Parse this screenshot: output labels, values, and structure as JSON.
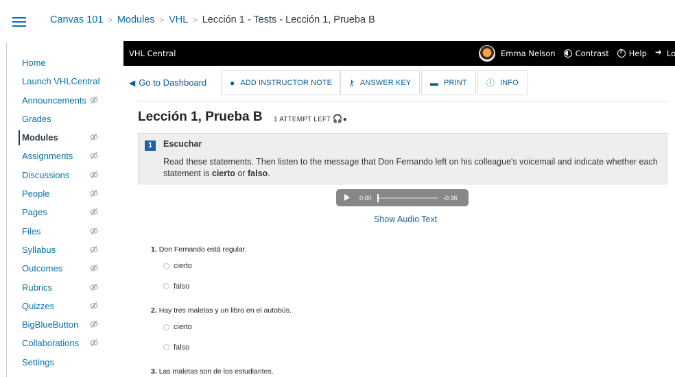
{
  "breadcrumb": {
    "items": [
      "Canvas 101",
      "Modules",
      "VHL",
      "Lección 1 - Tests - Lección 1, Prueba B"
    ],
    "separator": ">"
  },
  "course_nav": {
    "items": [
      {
        "label": "Home",
        "hidden_icon": false,
        "active": false
      },
      {
        "label": "Launch VHLCentral",
        "hidden_icon": false,
        "active": false
      },
      {
        "label": "Announcements",
        "hidden_icon": true,
        "active": false
      },
      {
        "label": "Grades",
        "hidden_icon": false,
        "active": false
      },
      {
        "label": "Modules",
        "hidden_icon": true,
        "active": true
      },
      {
        "label": "Assignments",
        "hidden_icon": true,
        "active": false
      },
      {
        "label": "Discussions",
        "hidden_icon": true,
        "active": false
      },
      {
        "label": "People",
        "hidden_icon": true,
        "active": false
      },
      {
        "label": "Pages",
        "hidden_icon": true,
        "active": false
      },
      {
        "label": "Files",
        "hidden_icon": true,
        "active": false
      },
      {
        "label": "Syllabus",
        "hidden_icon": true,
        "active": false
      },
      {
        "label": "Outcomes",
        "hidden_icon": true,
        "active": false
      },
      {
        "label": "Rubrics",
        "hidden_icon": true,
        "active": false
      },
      {
        "label": "Quizzes",
        "hidden_icon": true,
        "active": false
      },
      {
        "label": "BigBlueButton",
        "hidden_icon": true,
        "active": false
      },
      {
        "label": "Collaborations",
        "hidden_icon": true,
        "active": false
      },
      {
        "label": "Settings",
        "hidden_icon": false,
        "active": false
      }
    ]
  },
  "vhl_bar": {
    "brand": "VHL Central",
    "user_name": "Emma Nelson",
    "contrast": "Contrast",
    "help": "Help",
    "logout": "Logout"
  },
  "toolbar": {
    "dashboard": "Go to Dashboard",
    "instructor_note": "ADD INSTRUCTOR NOTE",
    "answer_key": "ANSWER KEY",
    "print": "PRINT",
    "info": "INFO"
  },
  "test": {
    "title": "Lección 1, Prueba B",
    "attempts": "1 ATTEMPT LEFT"
  },
  "section": {
    "number": "1",
    "title": "Escuchar",
    "body_pre": "Read these statements. Then listen to the message that Don Fernando left on his colleague's voicemail and indicate whether each statement is ",
    "body_b1": "cierto",
    "body_mid": " or ",
    "body_b2": "falso",
    "body_post": "."
  },
  "audio": {
    "current": "0:00",
    "remaining": "-0:36",
    "show_text": "Show Audio Text",
    "progress": 0
  },
  "questions": [
    {
      "num": "1.",
      "text": "Don Fernando está regular.",
      "options": [
        "cierto",
        "falso"
      ]
    },
    {
      "num": "2.",
      "text": "Hay tres maletas y un libro en el autobús.",
      "options": [
        "cierto",
        "falso"
      ]
    },
    {
      "num": "3.",
      "text": "Las maletas son de los estudiantes.",
      "options": []
    }
  ],
  "colors": {
    "link": "#0770a3",
    "vhl_link": "#0b5e93",
    "section_badge": "#1b63a0",
    "black_bar": "#000000"
  }
}
